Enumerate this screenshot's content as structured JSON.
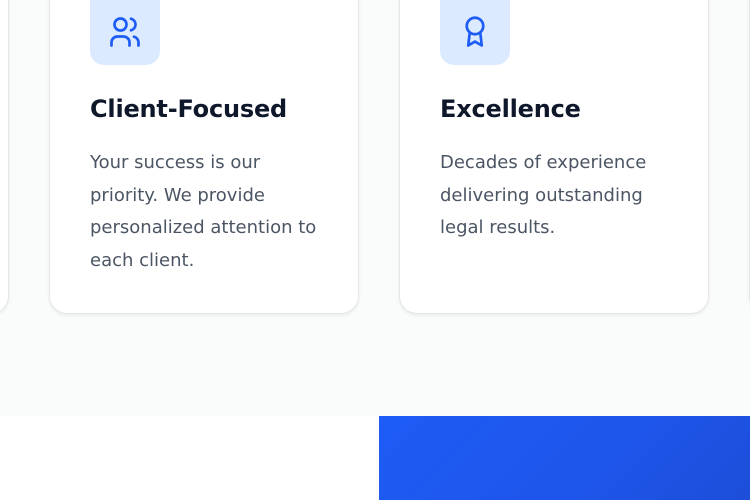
{
  "values": {
    "cards": [
      {
        "icon": "users-icon",
        "title": "Client-Focused",
        "description": "Your success is our priority. We provide personalized attention to each client."
      },
      {
        "icon": "award-ribbon-icon",
        "title": "Excellence",
        "description": "Decades of experience delivering outstanding legal results."
      }
    ]
  },
  "colors": {
    "accent": "#1d5cf5",
    "icon_tile_bg": "#dbeafe",
    "heading": "#0f172a",
    "body_text": "#4b5563",
    "section_bg": "#fafbfb"
  }
}
